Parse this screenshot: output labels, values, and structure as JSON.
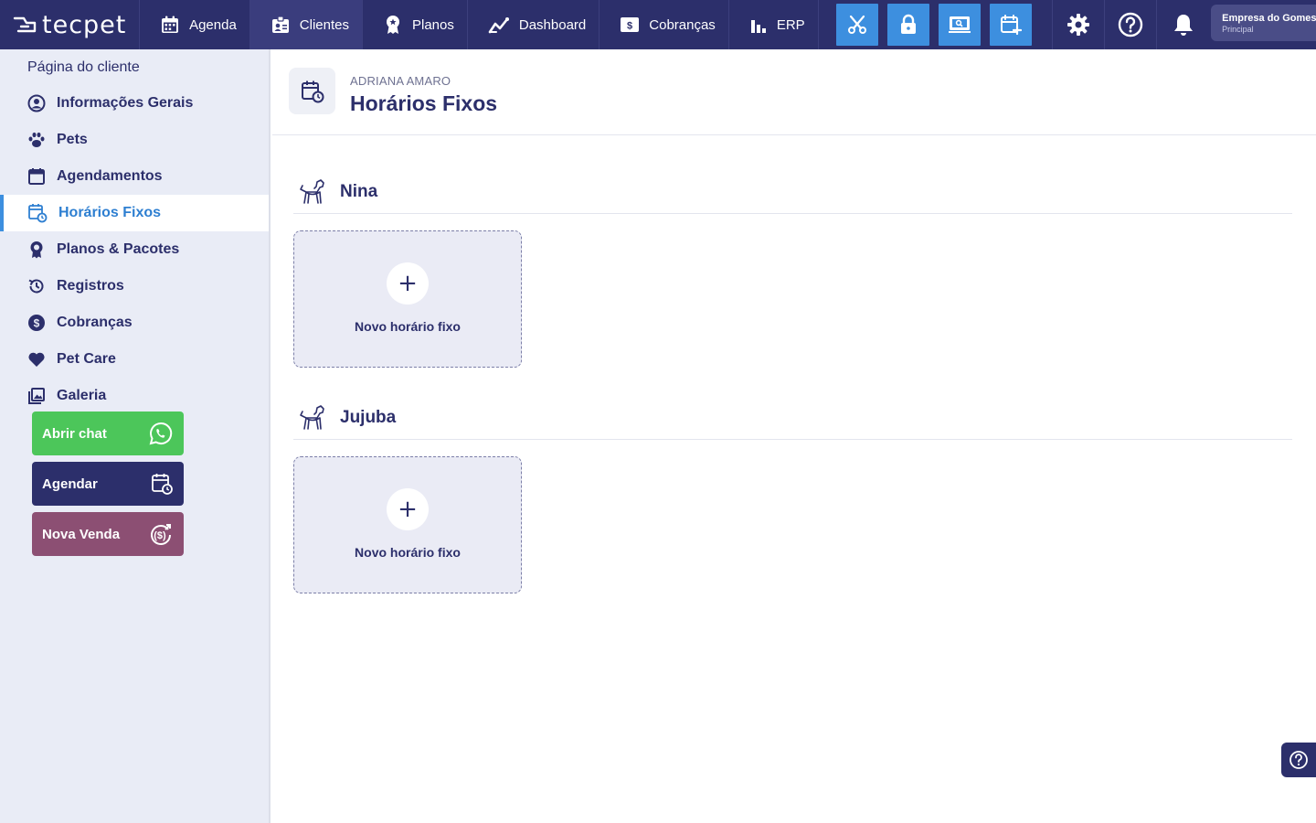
{
  "app": {
    "logo_text": "tecpet"
  },
  "nav": {
    "items": [
      {
        "label": "Agenda"
      },
      {
        "label": "Clientes"
      },
      {
        "label": "Planos"
      },
      {
        "label": "Dashboard"
      },
      {
        "label": "Cobranças"
      },
      {
        "label": "ERP"
      }
    ],
    "company_name": "Empresa do Gomes",
    "company_sub": "Principal"
  },
  "sidebar": {
    "title": "Página do cliente",
    "items": [
      {
        "label": "Informações Gerais"
      },
      {
        "label": "Pets"
      },
      {
        "label": "Agendamentos"
      },
      {
        "label": "Horários Fixos"
      },
      {
        "label": "Planos & Pacotes"
      },
      {
        "label": "Registros"
      },
      {
        "label": "Cobranças"
      },
      {
        "label": "Pet Care"
      },
      {
        "label": "Galeria"
      }
    ],
    "actions": [
      {
        "label": "Abrir chat",
        "color": "#4cc65a"
      },
      {
        "label": "Agendar",
        "color": "#2c2f6b"
      },
      {
        "label": "Nova Venda",
        "color": "#8c4f73"
      }
    ]
  },
  "header": {
    "client_name": "ADRIANA AMARO",
    "title": "Horários Fixos"
  },
  "pets": [
    {
      "name": "Nina",
      "add_label": "Novo horário fixo"
    },
    {
      "name": "Jujuba",
      "add_label": "Novo horário fixo"
    }
  ],
  "colors": {
    "nav_bg": "#2c2f6b",
    "accent": "#3d8fdf",
    "sidebar_bg": "#e9ecf6"
  }
}
